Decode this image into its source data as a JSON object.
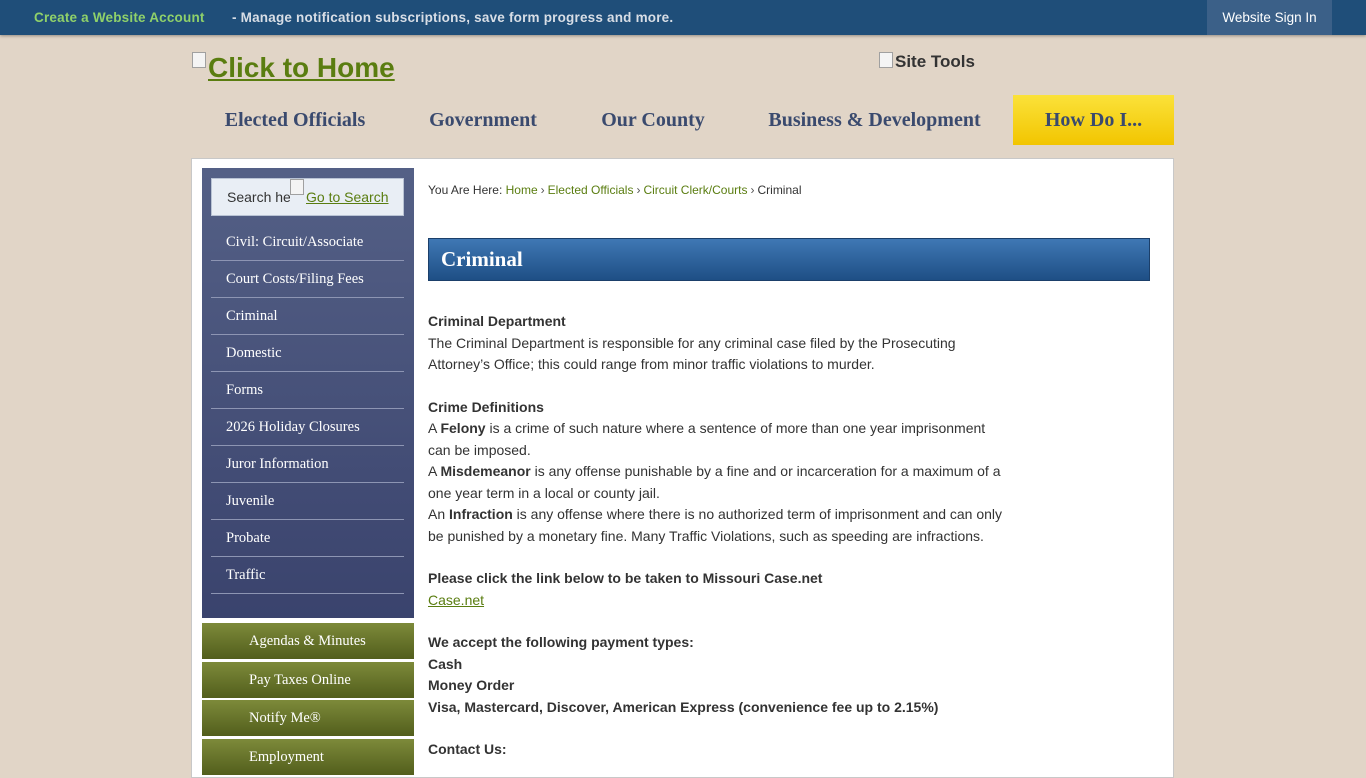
{
  "topbar": {
    "create_label": "Create a Website Account",
    "description": "- Manage notification subscriptions, save form progress and more.",
    "signin_label": "Website Sign In"
  },
  "header": {
    "home_link": "Click to Home",
    "site_tools": "Site Tools"
  },
  "mainnav": [
    "Elected Officials",
    "Government",
    "Our County",
    "Business & Development",
    "How Do I..."
  ],
  "search": {
    "placeholder": "Search here...",
    "visible_text": "Search he",
    "go_label": "Go to Search"
  },
  "sidebar": [
    "Civil: Circuit/Associate",
    "Court Costs/Filing Fees",
    "Criminal",
    "Domestic",
    "Forms",
    "2026 Holiday Closures",
    "Juror Information",
    "Juvenile",
    "Probate",
    "Traffic"
  ],
  "quicklinks": [
    "Agendas & Minutes",
    "Pay Taxes Online",
    "Notify Me®",
    "Employment"
  ],
  "breadcrumb": {
    "prefix": "You Are Here:",
    "home": "Home",
    "elected": "Elected Officials",
    "clerk": "Circuit Clerk/Courts",
    "current": "Criminal"
  },
  "page": {
    "title": "Criminal",
    "dept_heading": "Criminal Department",
    "dept_text": "The Criminal Department is responsible for any criminal case filed by the Prosecuting Attorney’s Office; this could range from minor traffic violations to murder.",
    "defs_heading": "Crime Definitions",
    "felony_pre": "A ",
    "felony_term": "Felony",
    "felony_text": " is a crime of such nature where a sentence of more than one year imprisonment can be imposed.",
    "misd_pre": "A ",
    "misd_term": "Misdemeanor",
    "misd_text": " is any offense punishable by a fine and or incarceration for a maximum of a one year term in a local or county jail.",
    "infr_pre": "An ",
    "infr_term": "Infraction",
    "infr_text": " is any offense where there is no authorized term of imprisonment and can only be punished by a monetary fine. Many Traffic Violations, such as speeding are infractions.",
    "casenet_heading": "Please click the link below to be taken to Missouri Case.net",
    "casenet_link": "Case.net",
    "payment_heading": "We accept the following payment types:",
    "payment_1": "Cash",
    "payment_2": "Money Order",
    "payment_3": "Visa, Mastercard, Discover, American Express (convenience fee up to 2.15%)",
    "contact_heading": "Contact Us:"
  },
  "colors": {
    "topbar": "#1f4e79",
    "accent_green": "#5a7d10",
    "nav_highlight": "#f2c500",
    "title_bar": "#2a5f9a"
  }
}
